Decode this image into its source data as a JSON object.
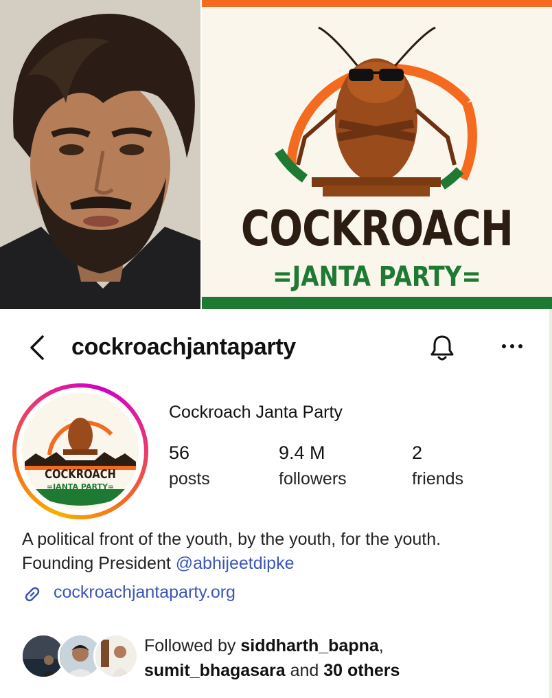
{
  "banner": {
    "title": "COCKROACH",
    "subtitle": "=JANTA PARTY="
  },
  "header": {
    "username": "cockroachjantaparty",
    "back_icon": "chevron-left-icon",
    "bell_icon": "bell-icon",
    "more_icon": "more-horizontal-icon"
  },
  "profile": {
    "display_name": "Cockroach Janta Party",
    "avatar_text_top": "COCKROACH",
    "avatar_text_bottom": "=JANTA PARTY=",
    "stats": [
      {
        "value": "56",
        "label": "posts"
      },
      {
        "value": "9.4 M",
        "label": "followers"
      },
      {
        "value": "2",
        "label": "friends"
      }
    ],
    "bio_line1": "A political front of the youth, by the youth, for the youth.",
    "bio_line2_prefix": "Founding President ",
    "bio_mention": "@abhijeetdipke",
    "link": "cockroachjantaparty.org",
    "link_icon": "link-icon"
  },
  "followed_by": {
    "prefix": "Followed by ",
    "user1": "siddharth_bapna",
    "comma": ",",
    "user2": "sumit_bhagasara",
    "suffix_mid": " and ",
    "others": "30 others"
  },
  "colors": {
    "saffron": "#f46a1f",
    "green": "#1e7a32",
    "link_blue": "#3a56b8"
  }
}
